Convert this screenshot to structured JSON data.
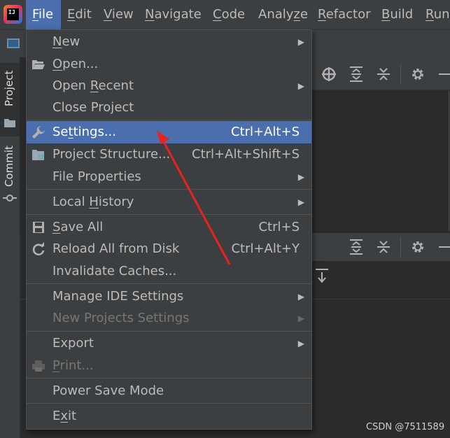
{
  "menubar": {
    "items": [
      {
        "label": "File",
        "mnemonic": "F",
        "rest": "ile"
      },
      {
        "label": "Edit",
        "mnemonic": "E",
        "rest": "dit"
      },
      {
        "label": "View",
        "mnemonic": "V",
        "rest": "iew"
      },
      {
        "label": "Navigate",
        "mnemonic": "N",
        "rest": "avigate"
      },
      {
        "label": "Code",
        "mnemonic": "C",
        "rest": "ode"
      },
      {
        "label": "Analyze",
        "pre": "Analy",
        "mnemonic": "z",
        "rest": "e"
      },
      {
        "label": "Refactor",
        "mnemonic": "R",
        "rest": "efactor"
      },
      {
        "label": "Build",
        "mnemonic": "B",
        "rest": "uild"
      },
      {
        "label": "Run",
        "mnemonic": "R",
        "rest": "un"
      }
    ]
  },
  "app_logo_text": "IJ",
  "side_tabs": {
    "project": "Project",
    "commit": "Commit"
  },
  "file_menu": {
    "new": {
      "mnemonic": "N",
      "rest": "ew"
    },
    "open": {
      "mnemonic": "O",
      "rest": "pen..."
    },
    "open_recent": {
      "pre": "Open ",
      "mnemonic": "R",
      "rest": "ecent"
    },
    "close_project": {
      "label": "Close Project"
    },
    "settings": {
      "pre": "Se",
      "mnemonic": "t",
      "rest": "tings...",
      "shortcut": "Ctrl+Alt+S"
    },
    "project_structure": {
      "label": "Project Structure...",
      "shortcut": "Ctrl+Alt+Shift+S"
    },
    "file_properties": {
      "label": "File Properties"
    },
    "local_history": {
      "pre": "Local ",
      "mnemonic": "H",
      "rest": "istory"
    },
    "save_all": {
      "mnemonic": "S",
      "rest": "ave All",
      "shortcut": "Ctrl+S"
    },
    "reload_all": {
      "label": "Reload All from Disk",
      "shortcut": "Ctrl+Alt+Y"
    },
    "invalidate_caches": {
      "label": "Invalidate Caches..."
    },
    "manage_ide_settings": {
      "label": "Manage IDE Settings"
    },
    "new_projects_settings": {
      "label": "New Projects Settings"
    },
    "export": {
      "label": "Export"
    },
    "print": {
      "mnemonic": "P",
      "rest": "rint..."
    },
    "power_save_mode": {
      "label": "Power Save Mode"
    },
    "exit": {
      "pre": "E",
      "mnemonic": "x",
      "rest": "it"
    }
  },
  "watermark": "CSDN @7511589",
  "colors": {
    "menu_bg": "#3c3f41",
    "selection": "#4b6eaf",
    "editor_bg": "#2b2b2b",
    "annotation_arrow": "#e8231e"
  }
}
